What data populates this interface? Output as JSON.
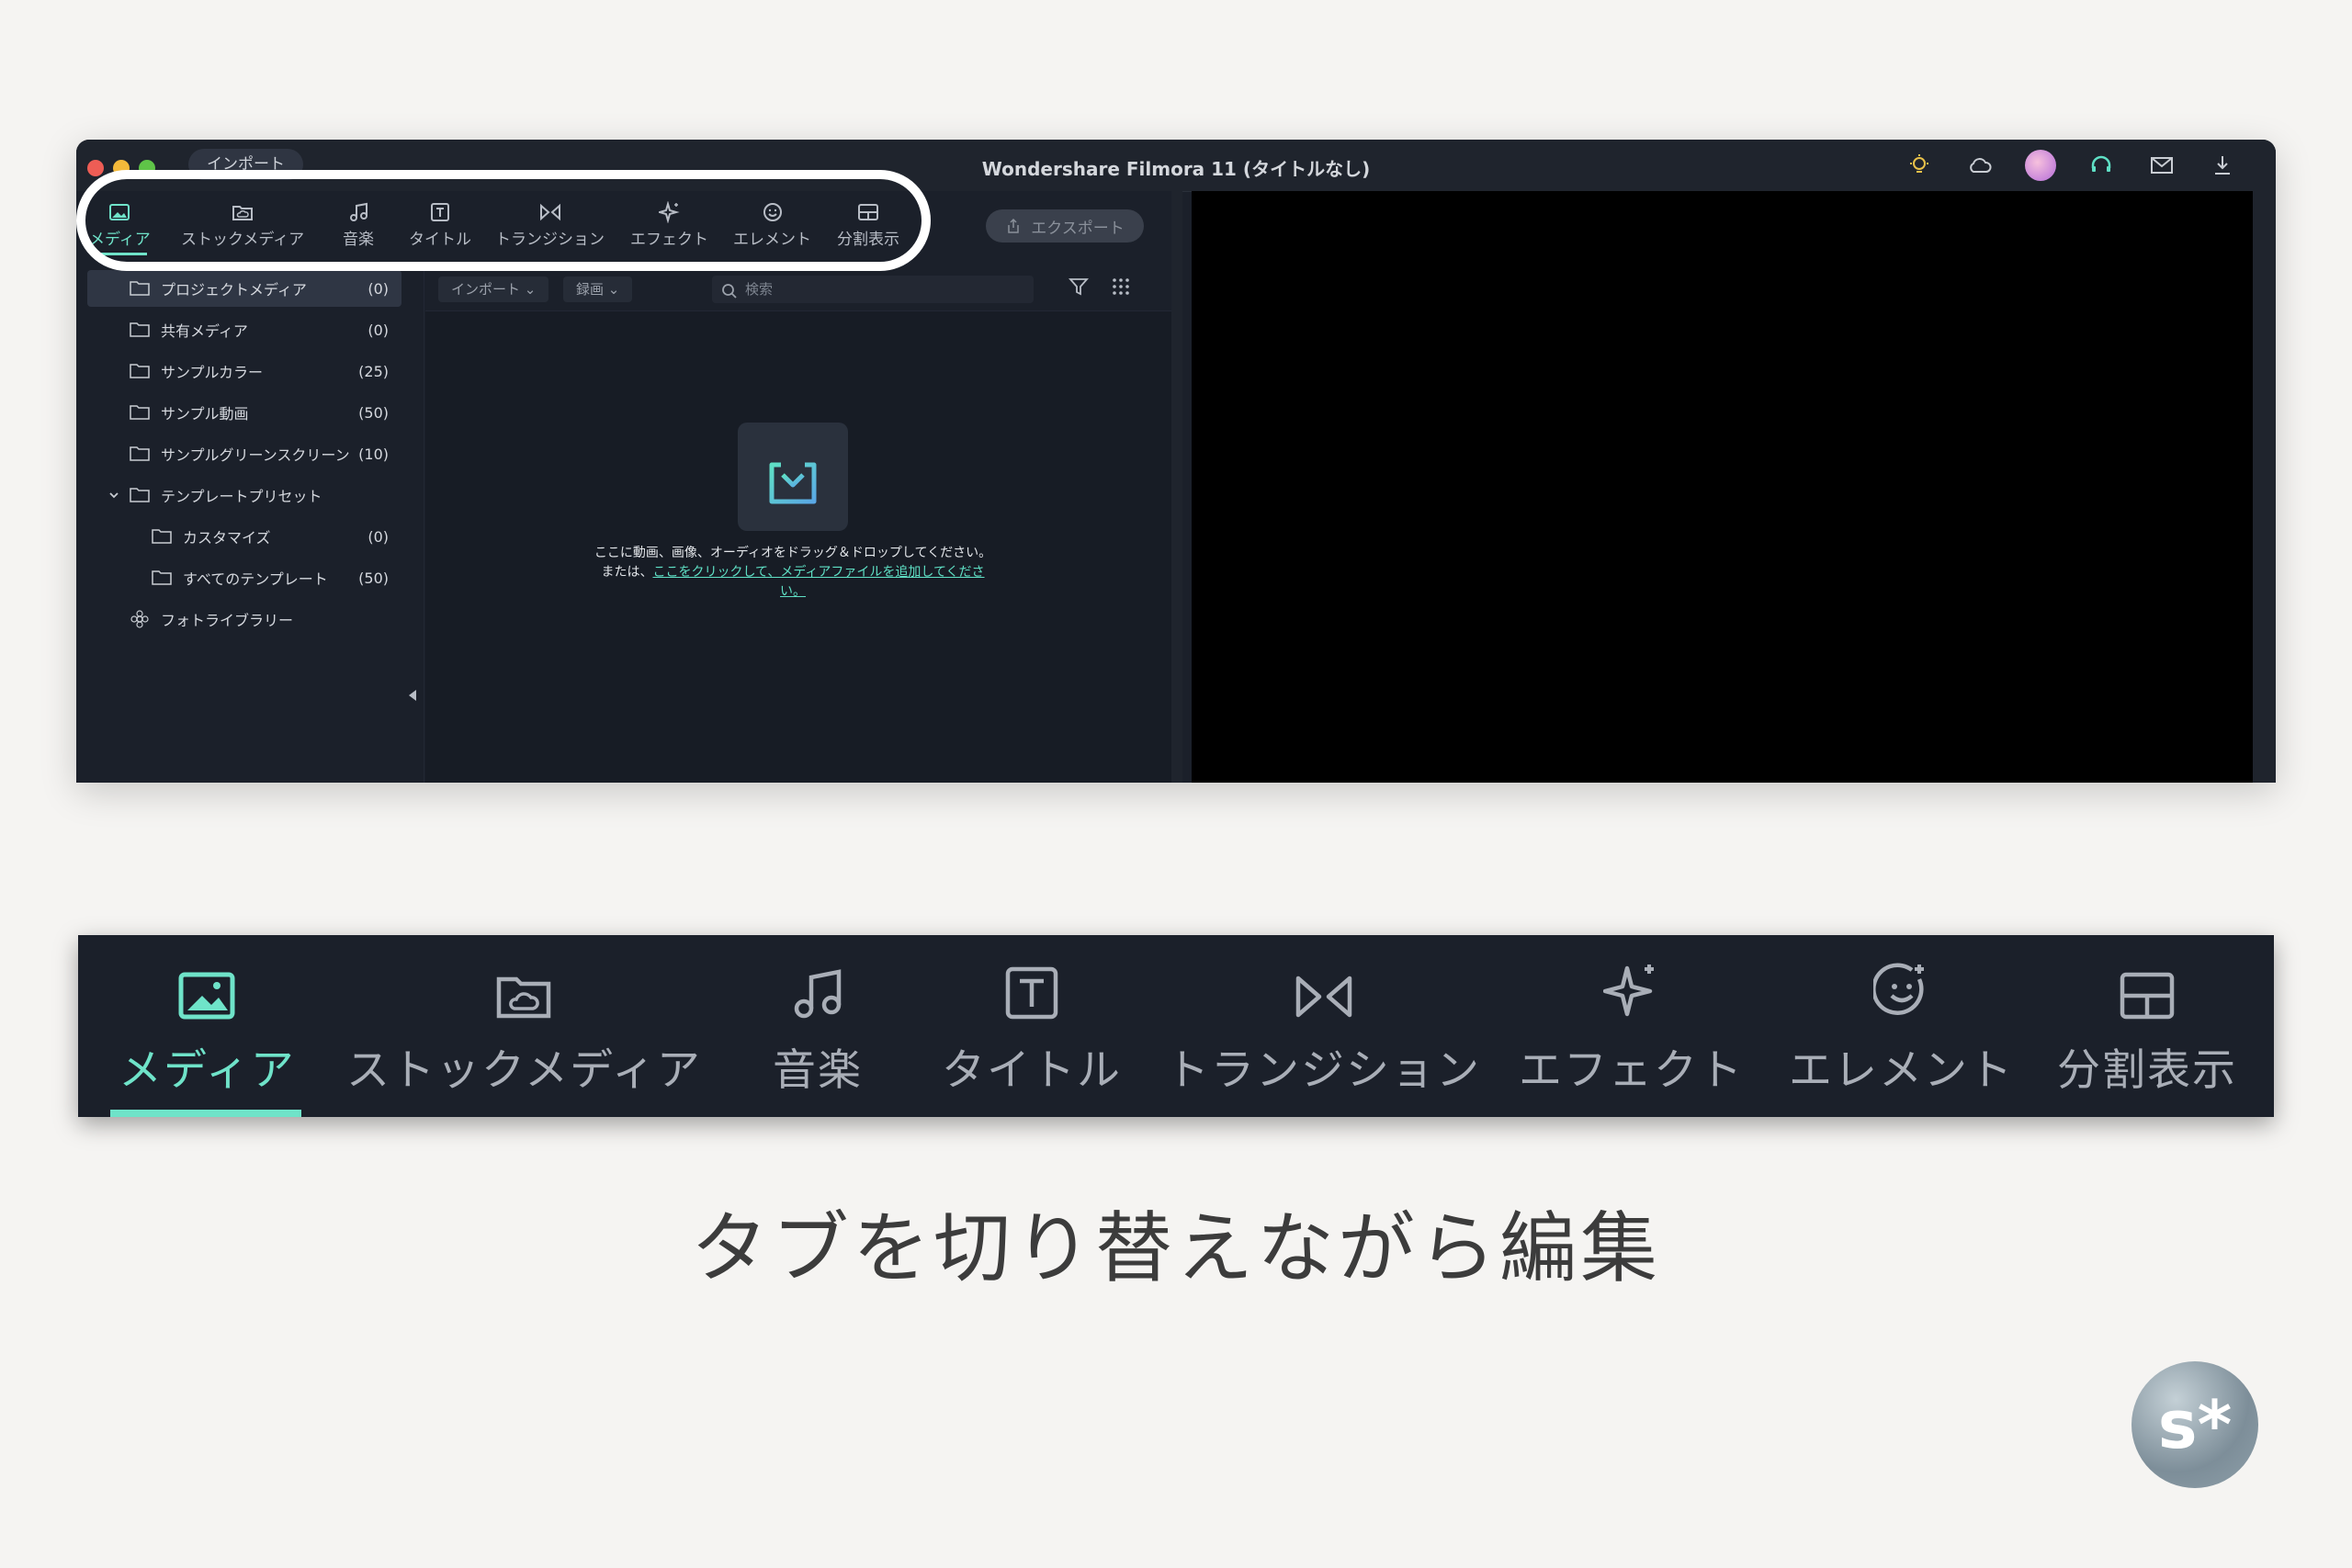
{
  "window": {
    "title": "Wondershare Filmora 11 (タイトルなし)",
    "import_pill": "インポート",
    "export_label": "エクスポート"
  },
  "tabs": [
    {
      "label": "メディア",
      "icon": "image-icon",
      "active": true
    },
    {
      "label": "ストックメディア",
      "icon": "cloud-folder-icon",
      "active": false
    },
    {
      "label": "音楽",
      "icon": "music-note-icon",
      "active": false
    },
    {
      "label": "タイトル",
      "icon": "title-t-icon",
      "active": false
    },
    {
      "label": "トランジション",
      "icon": "transition-icon",
      "active": false
    },
    {
      "label": "エフェクト",
      "icon": "sparkle-icon",
      "active": false
    },
    {
      "label": "エレメント",
      "icon": "smiley-sticker-icon",
      "active": false
    },
    {
      "label": "分割表示",
      "icon": "split-layout-icon",
      "active": false
    }
  ],
  "sidebar": {
    "items": [
      {
        "label": "プロジェクトメディア",
        "count": "(0)"
      },
      {
        "label": "共有メディア",
        "count": "(0)"
      },
      {
        "label": "サンプルカラー",
        "count": "(25)"
      },
      {
        "label": "サンプル動画",
        "count": "(50)"
      },
      {
        "label": "サンプルグリーンスクリーン",
        "count": "(10)"
      },
      {
        "label": "テンプレートプリセット",
        "count": ""
      },
      {
        "label": "カスタマイズ",
        "count": "(0)"
      },
      {
        "label": "すべてのテンプレート",
        "count": "(50)"
      },
      {
        "label": "フォトライブラリー",
        "count": ""
      }
    ]
  },
  "media": {
    "import_dropdown": "インポート",
    "record_dropdown": "録画",
    "search_placeholder": "検索",
    "drop_text": "ここに動画、画像、オーディオをドラッグ＆ドロップしてください。または、",
    "drop_link": "ここをクリックして、メディアファイルを追加してください。"
  },
  "caption": "タブを切り替えながら編集",
  "logo": "s*",
  "colors": {
    "accent": "#6fe3c9",
    "panel": "#1b202a",
    "background": "#f5f4f2"
  }
}
